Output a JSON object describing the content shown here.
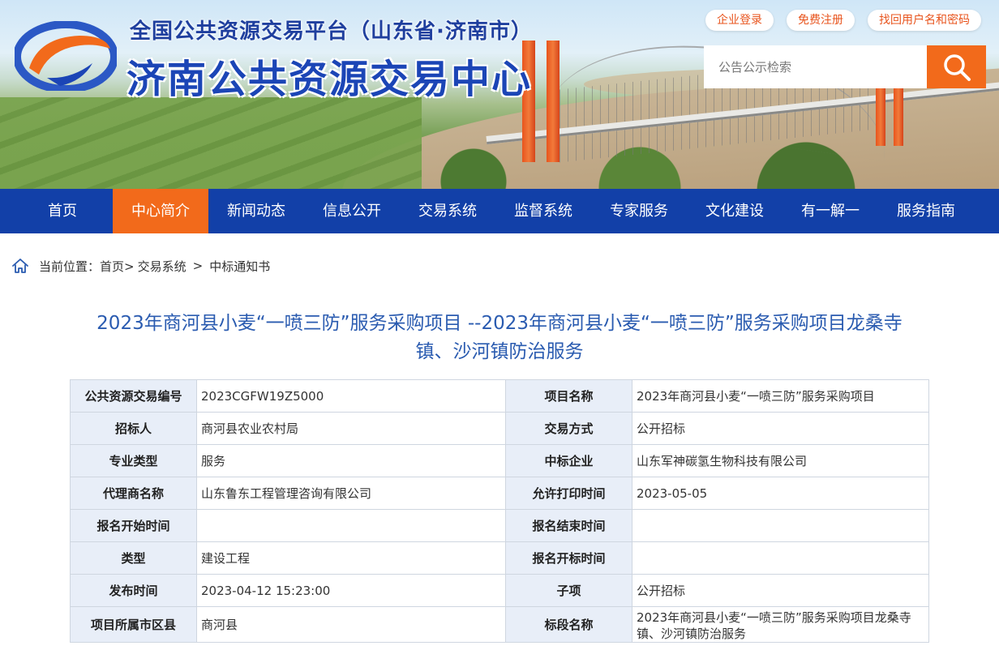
{
  "header": {
    "subtitle": "全国公共资源交易平台（山东省·济南市）",
    "title": "济南公共资源交易中心",
    "links": [
      "企业登录",
      "免费注册",
      "找回用户名和密码"
    ],
    "search_placeholder": "公告公示检索"
  },
  "nav": {
    "items": [
      "首页",
      "中心简介",
      "新闻动态",
      "信息公开",
      "交易系统",
      "监督系统",
      "专家服务",
      "文化建设",
      "有一解一",
      "服务指南"
    ],
    "active": "中心简介"
  },
  "breadcrumb": {
    "prefix": "当前位置：",
    "items": [
      "首页>",
      "交易系统",
      ">",
      "中标通知书"
    ]
  },
  "doc": {
    "title_line1": "2023年商河县小麦“一喷三防”服务采购项目 --2023年商河县小麦“一喷三防”服务采购项目龙桑寺",
    "title_line2": "镇、沙河镇防治服务"
  },
  "table": {
    "rows": [
      [
        "公共资源交易编号",
        "2023CGFW19Z5000",
        "项目名称",
        "2023年商河县小麦“一喷三防”服务采购项目"
      ],
      [
        "招标人",
        "商河县农业农村局",
        "交易方式",
        "公开招标"
      ],
      [
        "专业类型",
        "服务",
        "中标企业",
        "山东军神碳氢生物科技有限公司"
      ],
      [
        "代理商名称",
        "山东鲁东工程管理咨询有限公司",
        "允许打印时间",
        "2023-05-05"
      ],
      [
        "报名开始时间",
        "",
        "报名结束时间",
        ""
      ],
      [
        "类型",
        "建设工程",
        "报名开标时间",
        ""
      ],
      [
        "发布时间",
        "2023-04-12 15:23:00",
        "子项",
        "公开招标"
      ],
      [
        "项目所属市区县",
        "商河县",
        "标段名称",
        "2023年商河县小麦“一喷三防”服务采购项目龙桑寺镇、沙河镇防治服务"
      ]
    ]
  },
  "colors": {
    "primary_blue": "#1240a8",
    "accent_orange": "#f26a1b",
    "label_bg": "#e8eef8",
    "title_blue": "#2a5bb0"
  }
}
